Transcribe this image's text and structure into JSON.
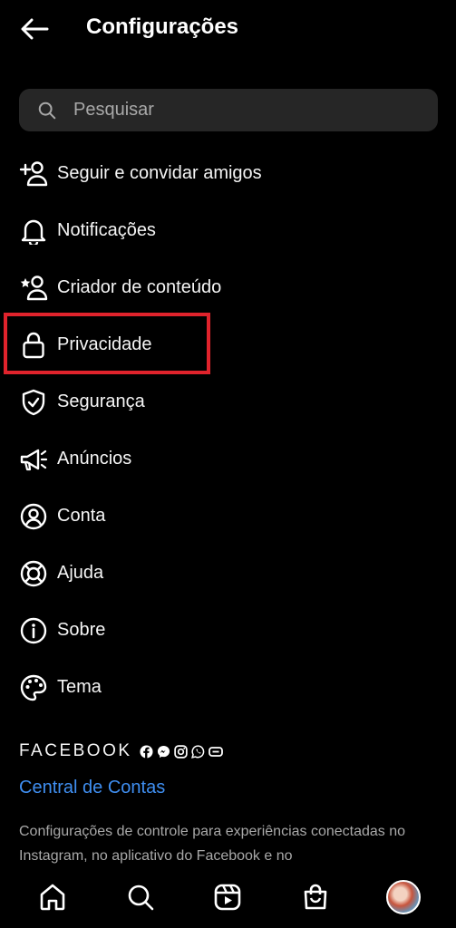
{
  "header": {
    "title": "Configurações"
  },
  "search": {
    "placeholder": "Pesquisar"
  },
  "menu": [
    {
      "label": "Seguir e convidar amigos",
      "icon": "add-person-icon"
    },
    {
      "label": "Notificações",
      "icon": "bell-icon"
    },
    {
      "label": "Criador de conteúdo",
      "icon": "star-person-icon"
    },
    {
      "label": "Privacidade",
      "icon": "lock-icon"
    },
    {
      "label": "Segurança",
      "icon": "shield-icon"
    },
    {
      "label": "Anúncios",
      "icon": "megaphone-icon"
    },
    {
      "label": "Conta",
      "icon": "account-circle-icon"
    },
    {
      "label": "Ajuda",
      "icon": "lifebuoy-icon"
    },
    {
      "label": "Sobre",
      "icon": "info-icon"
    },
    {
      "label": "Tema",
      "icon": "palette-icon"
    }
  ],
  "footer": {
    "brand": "FACEBOOK",
    "accounts_link": "Central de Contas",
    "description": "Configurações de controle para experiências conectadas no Instagram, no aplicativo do Facebook e no"
  },
  "colors": {
    "background": "#000000",
    "link": "#3f8ef0",
    "highlight": "#e0232c",
    "search_bg": "#262626"
  }
}
